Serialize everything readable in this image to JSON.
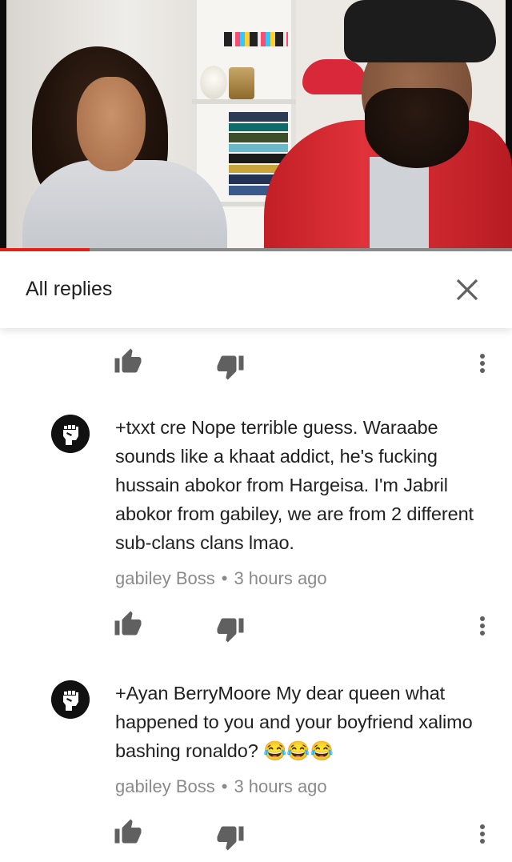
{
  "video": {
    "progress": 0.175
  },
  "replies_panel": {
    "title": "All replies"
  },
  "comments": [
    {
      "text": "+txxt cre Nope terrible guess. Waraabe sounds like a khaat addict, he's fucking hussain abokor from Hargeisa. I'm Jabril abokor from gabiley, we are from 2 different sub-clans clans lmao.",
      "author": "gabiley Boss",
      "time": "3 hours ago"
    },
    {
      "text": "+Ayan BerryMoore My dear queen what happened to you and your boyfriend xalimo bashing ronaldo? 😂😂😂",
      "author": "gabiley Boss",
      "time": "3 hours ago"
    }
  ],
  "icons": {
    "like": "thumbs-up-icon",
    "dislike": "thumbs-down-icon",
    "more": "more-vertical-icon",
    "close": "close-icon",
    "avatar": "raised-fist-icon"
  },
  "colors": {
    "progress_played": "#e62117",
    "progress_track": "#8b8b8b",
    "meta_text": "#8a8a8a",
    "icon": "#606060"
  }
}
